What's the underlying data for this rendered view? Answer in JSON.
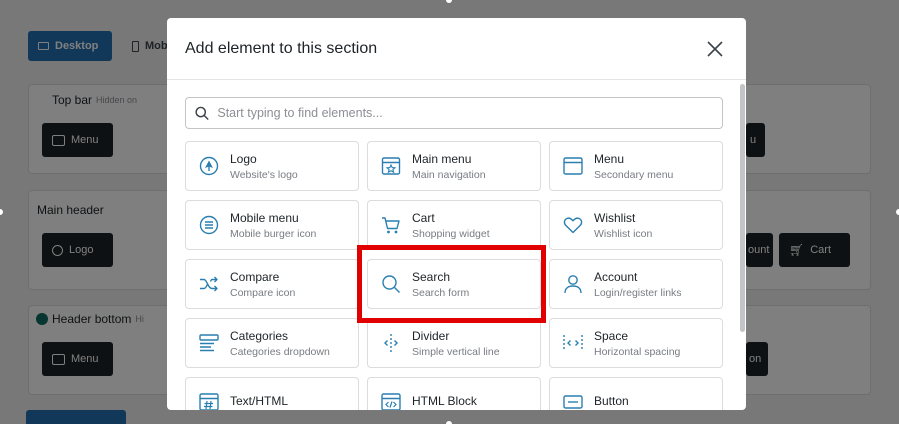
{
  "background": {
    "tabs": {
      "desktop": "Desktop",
      "mobile": "Mob"
    },
    "top_bar": {
      "label": "Top bar",
      "note": "Hidden on"
    },
    "main_header": {
      "label": "Main header"
    },
    "header_bottom": {
      "label": "Header bottom",
      "note": "Hi"
    },
    "pills": {
      "top_menu": "Menu",
      "top_right": "u",
      "main_logo": "Logo",
      "main_account": "ount",
      "main_cart": "Cart",
      "bottom_menu": "Menu",
      "bottom_right": "on"
    }
  },
  "modal": {
    "title": "Add element to this section",
    "search_placeholder": "Start typing to find elements...",
    "elements": [
      {
        "name": "Logo",
        "desc": "Website's logo",
        "icon": "logo-icon"
      },
      {
        "name": "Main menu",
        "desc": "Main navigation",
        "icon": "main-menu-icon"
      },
      {
        "name": "Menu",
        "desc": "Secondary menu",
        "icon": "menu-icon"
      },
      {
        "name": "Mobile menu",
        "desc": "Mobile burger icon",
        "icon": "mobile-menu-icon"
      },
      {
        "name": "Cart",
        "desc": "Shopping widget",
        "icon": "cart-icon"
      },
      {
        "name": "Wishlist",
        "desc": "Wishlist icon",
        "icon": "heart-icon"
      },
      {
        "name": "Compare",
        "desc": "Compare icon",
        "icon": "compare-icon"
      },
      {
        "name": "Search",
        "desc": "Search form",
        "icon": "search-icon"
      },
      {
        "name": "Account",
        "desc": "Login/register links",
        "icon": "account-icon"
      },
      {
        "name": "Categories",
        "desc": "Categories dropdown",
        "icon": "categories-icon"
      },
      {
        "name": "Divider",
        "desc": "Simple vertical line",
        "icon": "divider-icon"
      },
      {
        "name": "Space",
        "desc": "Horizontal spacing",
        "icon": "space-icon"
      },
      {
        "name": "Text/HTML",
        "desc": "",
        "icon": "text-html-icon"
      },
      {
        "name": "HTML Block",
        "desc": "",
        "icon": "html-block-icon"
      },
      {
        "name": "Button",
        "desc": "",
        "icon": "button-icon"
      }
    ]
  },
  "colors": {
    "icon": "#2a7fb0",
    "highlight": "#e00000",
    "primary": "#2271b1"
  }
}
